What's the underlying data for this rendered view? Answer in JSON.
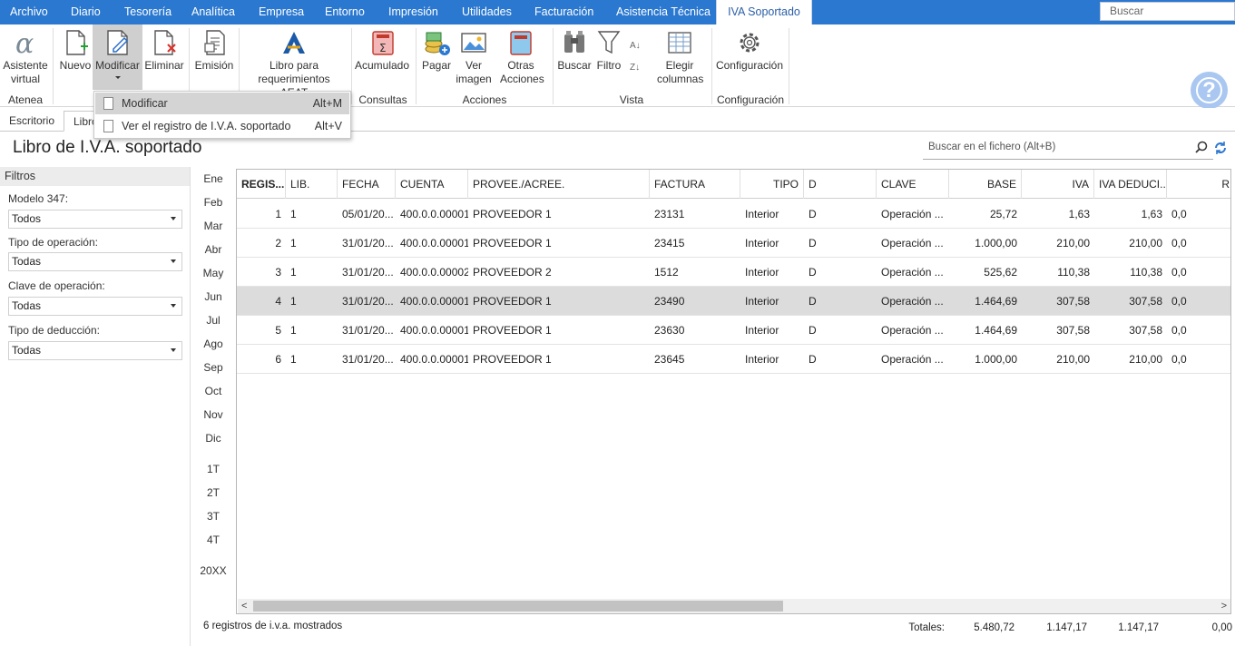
{
  "menu": {
    "items": [
      "Archivo",
      "Diario",
      "Tesorería",
      "Analítica",
      "Empresa",
      "Entorno",
      "Impresión",
      "Utilidades",
      "Facturación",
      "Asistencia Técnica",
      "IVA Soportado"
    ],
    "search_placeholder": "Buscar"
  },
  "ribbon": {
    "asistente": "Asistente virtual",
    "nuevo": "Nuevo",
    "modificar": "Modificar",
    "eliminar": "Eliminar",
    "emision": "Emisión",
    "libro": "Libro para requerimientos AEAT",
    "acumulado": "Acumulado",
    "pagar": "Pagar",
    "ver_imagen": "Ver imagen",
    "otras_acciones": "Otras Acciones",
    "buscar": "Buscar",
    "filtro": "Filtro",
    "elegir_columnas": "Elegir columnas",
    "configuracion": "Configuración",
    "groups": {
      "atenea": "Atenea",
      "consultas": "Consultas",
      "acciones": "Acciones",
      "vista": "Vista",
      "configuracion": "Configuración"
    }
  },
  "dropdown": {
    "items": [
      {
        "label": "Modificar",
        "shortcut": "Alt+M"
      },
      {
        "label": "Ver el registro de I.V.A. soportado",
        "shortcut": "Alt+V"
      }
    ]
  },
  "tabs": [
    "Escritorio",
    "Libro"
  ],
  "page_title": "Libro de I.V.A. soportado",
  "file_search_placeholder": "Buscar en el fichero (Alt+B)",
  "filters": {
    "header": "Filtros",
    "fields": [
      {
        "label": "Modelo 347:",
        "value": "Todos"
      },
      {
        "label": "Tipo de operación:",
        "value": "Todas"
      },
      {
        "label": "Clave de operación:",
        "value": "Todas"
      },
      {
        "label": "Tipo de deducción:",
        "value": "Todas"
      }
    ]
  },
  "months": [
    "Ene",
    "Feb",
    "Mar",
    "Abr",
    "May",
    "Jun",
    "Jul",
    "Ago",
    "Sep",
    "Oct",
    "Nov",
    "Dic"
  ],
  "quarters": [
    "1T",
    "2T",
    "3T",
    "4T"
  ],
  "year": "20XX",
  "table": {
    "headers": [
      "REGIS...",
      "LIB.",
      "FECHA",
      "CUENTA",
      "PROVEE./ACREE.",
      "FACTURA",
      "TIPO",
      "D",
      "CLAVE",
      "BASE",
      "IVA",
      "IVA DEDUCI...",
      "R"
    ],
    "rows": [
      [
        "1",
        "1",
        "05/01/20...",
        "400.0.0.00001",
        "PROVEEDOR 1",
        "23131",
        "Interior",
        "D",
        "Operación ...",
        "25,72",
        "1,63",
        "1,63",
        "0,0"
      ],
      [
        "2",
        "1",
        "31/01/20...",
        "400.0.0.00001",
        "PROVEEDOR 1",
        "23415",
        "Interior",
        "D",
        "Operación ...",
        "1.000,00",
        "210,00",
        "210,00",
        "0,0"
      ],
      [
        "3",
        "1",
        "31/01/20...",
        "400.0.0.00002",
        "PROVEEDOR 2",
        "1512",
        "Interior",
        "D",
        "Operación ...",
        "525,62",
        "110,38",
        "110,38",
        "0,0"
      ],
      [
        "4",
        "1",
        "31/01/20...",
        "400.0.0.00001",
        "PROVEEDOR 1",
        "23490",
        "Interior",
        "D",
        "Operación ...",
        "1.464,69",
        "307,58",
        "307,58",
        "0,0"
      ],
      [
        "5",
        "1",
        "31/01/20...",
        "400.0.0.00001",
        "PROVEEDOR 1",
        "23630",
        "Interior",
        "D",
        "Operación ...",
        "1.464,69",
        "307,58",
        "307,58",
        "0,0"
      ],
      [
        "6",
        "1",
        "31/01/20...",
        "400.0.0.00001",
        "PROVEEDOR 1",
        "23645",
        "Interior",
        "D",
        "Operación ...",
        "1.000,00",
        "210,00",
        "210,00",
        "0,0"
      ]
    ],
    "selected_row": 4
  },
  "status": "6 registros de i.v.a. mostrados",
  "totals": {
    "label": "Totales:",
    "base": "5.480,72",
    "iva": "1.147,17",
    "iva_deducible": "1.147,17",
    "r": "0,00"
  },
  "colors": {
    "menubar": "#2b78d0",
    "selected_row": "#dcdcdc",
    "help": "#a9c7f0"
  }
}
